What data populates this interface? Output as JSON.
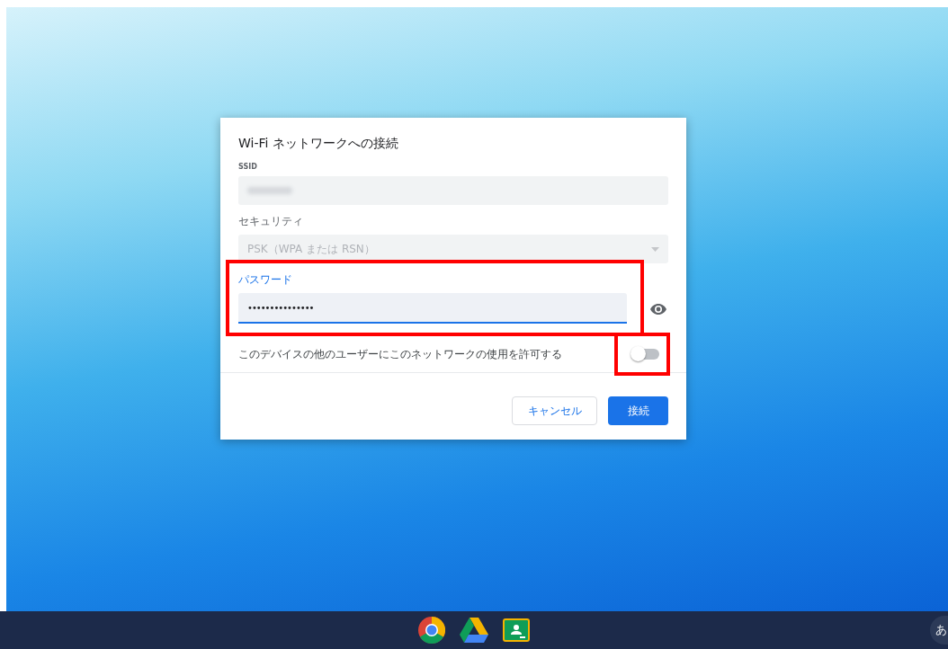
{
  "dialog": {
    "title": "Wi-Fi ネットワークへの接続",
    "fields": [
      {
        "kind": "blurred",
        "label": "SSID"
      },
      {
        "kind": "select",
        "label": "セキュリティ",
        "value": "PSK（WPA または RSN）",
        "disabled": true
      },
      {
        "kind": "password",
        "label": "パスワード",
        "value": "•••••••••••••••",
        "focused": true,
        "highlighted": true
      }
    ],
    "share_toggle": {
      "label": "このデバイスの他のユーザーにこのネットワークの使用を許可する",
      "on": false,
      "highlighted": true
    },
    "buttons": [
      {
        "label": "キャンセル",
        "kind": "secondary"
      },
      {
        "label": "接続",
        "kind": "primary"
      }
    ]
  },
  "taskbar": {
    "ime_indicator": "あ"
  }
}
